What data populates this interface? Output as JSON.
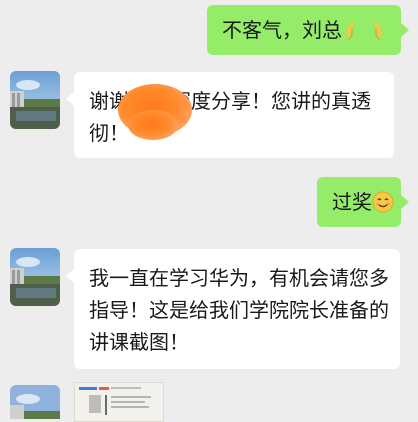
{
  "messages": [
    {
      "sender": "me",
      "text": "不客气，刘总",
      "emoji": "folded-hands-emoji ×2"
    },
    {
      "sender": "them",
      "line1_prefix": "谢谢",
      "line1_suffix": "深度分享！您讲的真透",
      "line2": "彻！",
      "redacted": true
    },
    {
      "sender": "me",
      "text": "过奖",
      "emoji": "smiling-face-emoji"
    },
    {
      "sender": "them",
      "lines": [
        "我一直在学习华为，有机会请您多",
        "指导！这是给我们学院院长准备的",
        "讲课截图！"
      ]
    },
    {
      "sender": "them",
      "type": "image"
    }
  ],
  "colors": {
    "background": "#ededed",
    "my_bubble": "#95ec69",
    "their_bubble": "#ffffff",
    "text": "#191919",
    "redaction": "#ff7a1a"
  }
}
